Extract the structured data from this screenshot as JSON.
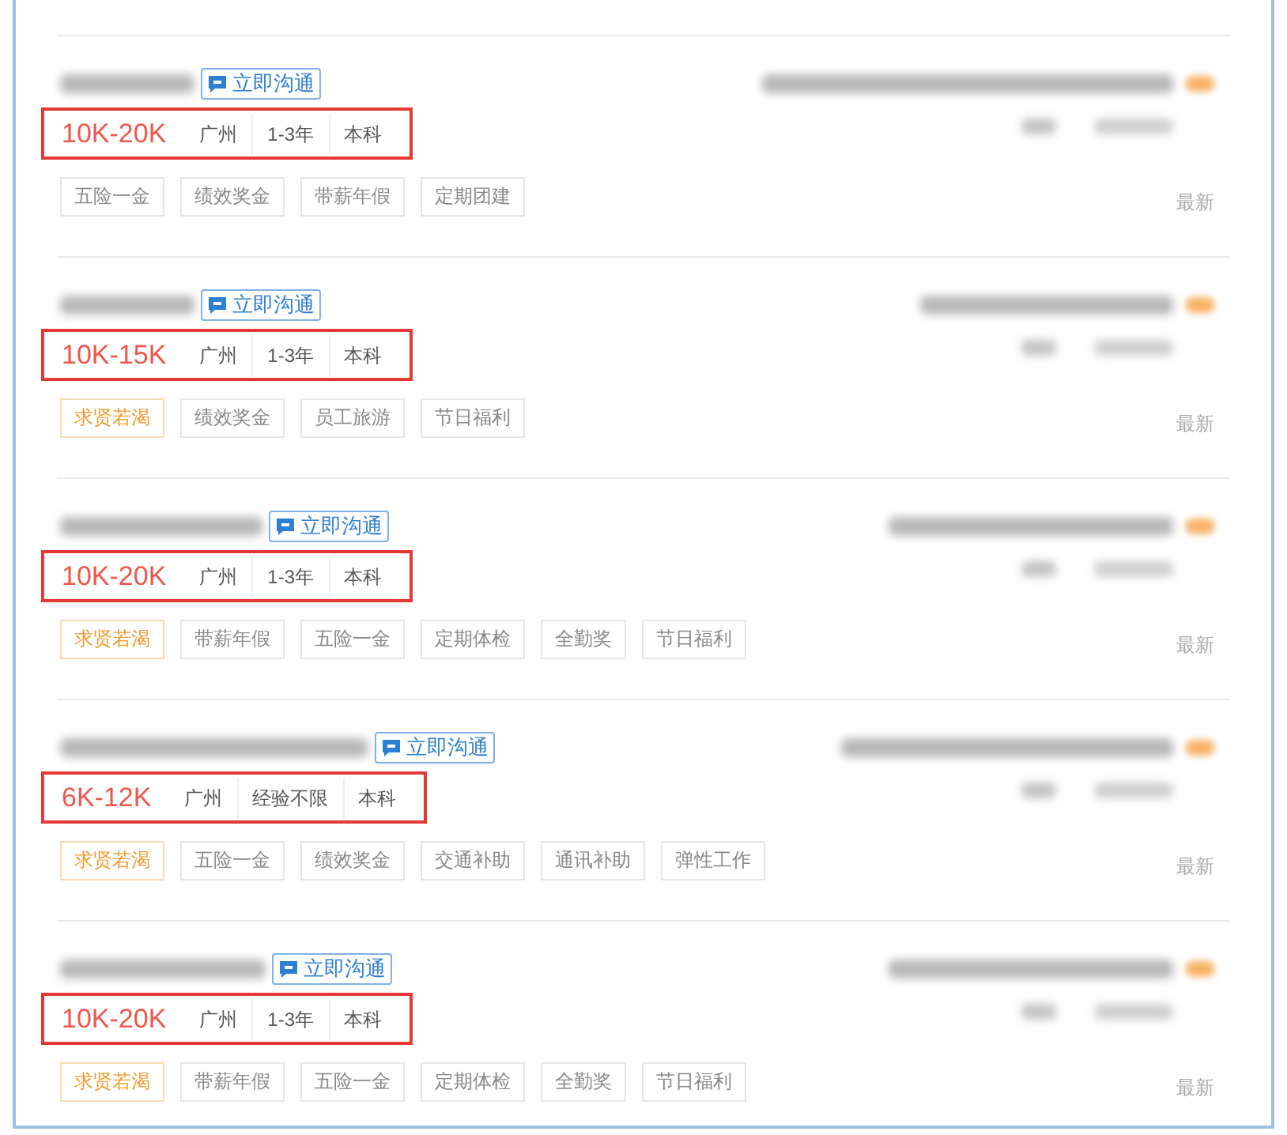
{
  "jobs": [
    {
      "chat_button": "立即沟通",
      "salary": "10K-20K",
      "city": "广州",
      "experience": "1-3年",
      "education": "本科",
      "tags": [
        {
          "label": "五险一金",
          "kind": "plain"
        },
        {
          "label": "绩效奖金",
          "kind": "plain"
        },
        {
          "label": "带薪年假",
          "kind": "plain"
        },
        {
          "label": "定期团建",
          "kind": "plain"
        }
      ],
      "posted": "最新"
    },
    {
      "chat_button": "立即沟通",
      "salary": "10K-15K",
      "city": "广州",
      "experience": "1-3年",
      "education": "本科",
      "tags": [
        {
          "label": "求贤若渴",
          "kind": "urgent"
        },
        {
          "label": "绩效奖金",
          "kind": "plain"
        },
        {
          "label": "员工旅游",
          "kind": "plain"
        },
        {
          "label": "节日福利",
          "kind": "plain"
        }
      ],
      "posted": "最新"
    },
    {
      "chat_button": "立即沟通",
      "salary": "10K-20K",
      "city": "广州",
      "experience": "1-3年",
      "education": "本科",
      "tags": [
        {
          "label": "求贤若渴",
          "kind": "urgent"
        },
        {
          "label": "带薪年假",
          "kind": "plain"
        },
        {
          "label": "五险一金",
          "kind": "plain"
        },
        {
          "label": "定期体检",
          "kind": "plain"
        },
        {
          "label": "全勤奖",
          "kind": "plain"
        },
        {
          "label": "节日福利",
          "kind": "plain"
        }
      ],
      "posted": "最新"
    },
    {
      "chat_button": "立即沟通",
      "salary": "6K-12K",
      "city": "广州",
      "experience": "经验不限",
      "education": "本科",
      "tags": [
        {
          "label": "求贤若渴",
          "kind": "urgent"
        },
        {
          "label": "五险一金",
          "kind": "plain"
        },
        {
          "label": "绩效奖金",
          "kind": "plain"
        },
        {
          "label": "交通补助",
          "kind": "plain"
        },
        {
          "label": "通讯补助",
          "kind": "plain"
        },
        {
          "label": "弹性工作",
          "kind": "plain"
        }
      ],
      "posted": "最新"
    },
    {
      "chat_button": "立即沟通",
      "salary": "10K-20K",
      "city": "广州",
      "experience": "1-3年",
      "education": "本科",
      "tags": [
        {
          "label": "求贤若渴",
          "kind": "urgent"
        },
        {
          "label": "带薪年假",
          "kind": "plain"
        },
        {
          "label": "五险一金",
          "kind": "plain"
        },
        {
          "label": "定期体检",
          "kind": "plain"
        },
        {
          "label": "全勤奖",
          "kind": "plain"
        },
        {
          "label": "节日福利",
          "kind": "plain"
        }
      ],
      "posted": "最新"
    }
  ]
}
